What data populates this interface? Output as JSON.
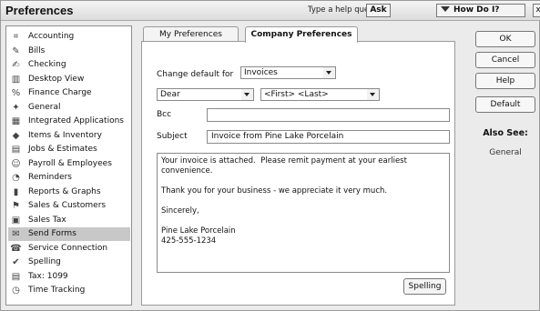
{
  "window": {
    "title": "Preferences",
    "help_question": "Type a help question",
    "ask_label": "Ask",
    "how_do_label": "How Do I?",
    "close_label": "x"
  },
  "sidebar": {
    "items": [
      {
        "label": "Accounting",
        "icon": "accounting-icon",
        "glyph": "⌗"
      },
      {
        "label": "Bills",
        "icon": "bills-icon",
        "glyph": "✎"
      },
      {
        "label": "Checking",
        "icon": "checking-icon",
        "glyph": "✍"
      },
      {
        "label": "Desktop View",
        "icon": "desktop-view-icon",
        "glyph": "▥"
      },
      {
        "label": "Finance Charge",
        "icon": "finance-charge-icon",
        "glyph": "%"
      },
      {
        "label": "General",
        "icon": "general-icon",
        "glyph": "✦"
      },
      {
        "label": "Integrated Applications",
        "icon": "integrated-applications-icon",
        "glyph": "▦"
      },
      {
        "label": "Items & Inventory",
        "icon": "items-inventory-icon",
        "glyph": "◆"
      },
      {
        "label": "Jobs & Estimates",
        "icon": "jobs-estimates-icon",
        "glyph": "▤"
      },
      {
        "label": "Payroll & Employees",
        "icon": "payroll-employees-icon",
        "glyph": "☺"
      },
      {
        "label": "Reminders",
        "icon": "reminders-icon",
        "glyph": "◔"
      },
      {
        "label": "Reports & Graphs",
        "icon": "reports-graphs-icon",
        "glyph": "▮"
      },
      {
        "label": "Sales & Customers",
        "icon": "sales-customers-icon",
        "glyph": "⚑"
      },
      {
        "label": "Sales Tax",
        "icon": "sales-tax-icon",
        "glyph": "▣"
      },
      {
        "label": "Send Forms",
        "icon": "send-forms-icon",
        "glyph": "✉"
      },
      {
        "label": "Service Connection",
        "icon": "service-connection-icon",
        "glyph": "☎"
      },
      {
        "label": "Spelling",
        "icon": "spelling-icon",
        "glyph": "✔"
      },
      {
        "label": "Tax: 1099",
        "icon": "tax-1099-icon",
        "glyph": "▤"
      },
      {
        "label": "Time Tracking",
        "icon": "time-tracking-icon",
        "glyph": "◷"
      }
    ],
    "selected": "Send Forms"
  },
  "tabs": {
    "my": "My Preferences",
    "company": "Company Preferences"
  },
  "form": {
    "change_default_label": "Change default for",
    "change_default_value": "Invoices",
    "salutation_value": "Dear",
    "name_format_value": "<First> <Last>",
    "bcc_label": "Bcc",
    "bcc_value": "",
    "subject_label": "Subject",
    "subject_value": "Invoice from Pine Lake Porcelain",
    "body_lines": [
      "Your invoice is attached.  Please remit payment at your earliest convenience.",
      "",
      "Thank you for your business - we appreciate it very much.",
      "",
      "Sincerely,",
      "",
      "Pine Lake Porcelain",
      "425-555-1234"
    ],
    "spelling_label": "Spelling"
  },
  "buttons": {
    "ok": "OK",
    "cancel": "Cancel",
    "help": "Help",
    "default": "Default"
  },
  "also_see": {
    "heading": "Also See:",
    "links": [
      "General"
    ]
  }
}
